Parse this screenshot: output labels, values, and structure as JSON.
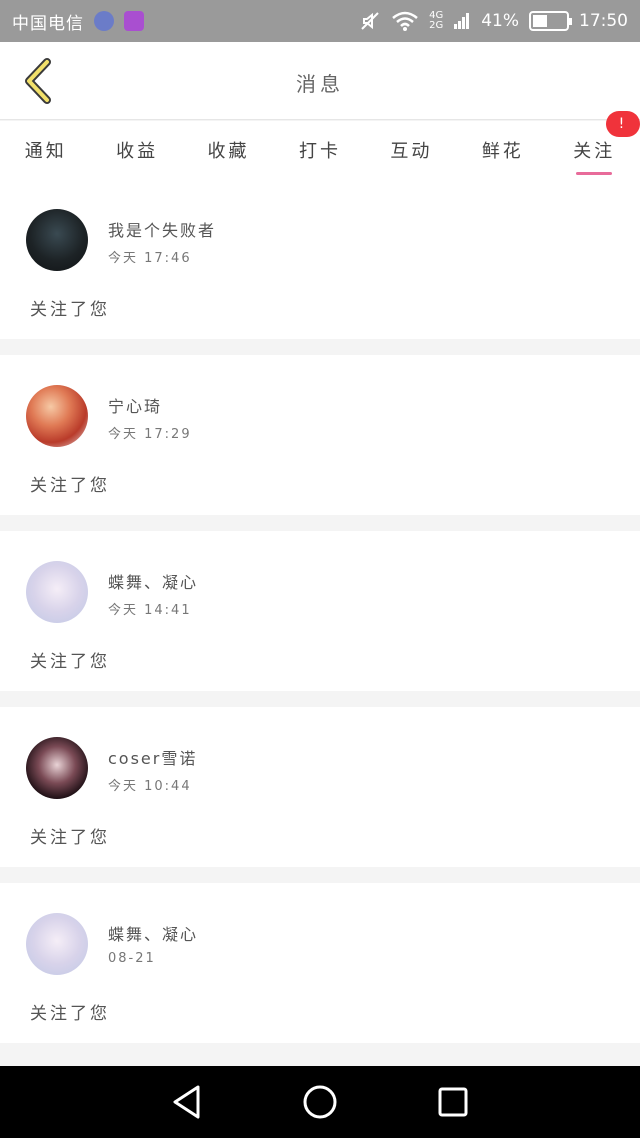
{
  "status_bar": {
    "carrier": "中国电信",
    "network_top": "4G",
    "network_bottom": "2G",
    "battery": "41%",
    "time": "17:50"
  },
  "header": {
    "title": "消息"
  },
  "tabs": [
    {
      "label": "通知"
    },
    {
      "label": "收益"
    },
    {
      "label": "收藏"
    },
    {
      "label": "打卡"
    },
    {
      "label": "互动"
    },
    {
      "label": "鲜花"
    },
    {
      "label": "关注",
      "active": true,
      "badge": "!"
    }
  ],
  "messages": [
    {
      "name": "我是个失败者",
      "time": "今天 17:46",
      "text": "关注了您"
    },
    {
      "name": "宁心琦",
      "time": "今天 17:29",
      "text": "关注了您"
    },
    {
      "name": "蝶舞、凝心",
      "time": "今天 14:41",
      "text": "关注了您"
    },
    {
      "name": "coser雪诺",
      "time": "今天 10:44",
      "text": "关注了您"
    },
    {
      "name": "蝶舞、凝心",
      "time": "08-21",
      "text": "关注了您"
    }
  ],
  "colors": {
    "accent_pink": "#e86b9a",
    "badge_red": "#f0333b",
    "status_bar_gray": "#9a9a9a"
  },
  "icons": {
    "back": "chevron-left-icon",
    "nav_back": "triangle-back-icon",
    "nav_home": "circle-home-icon",
    "nav_recent": "square-recent-icon"
  }
}
